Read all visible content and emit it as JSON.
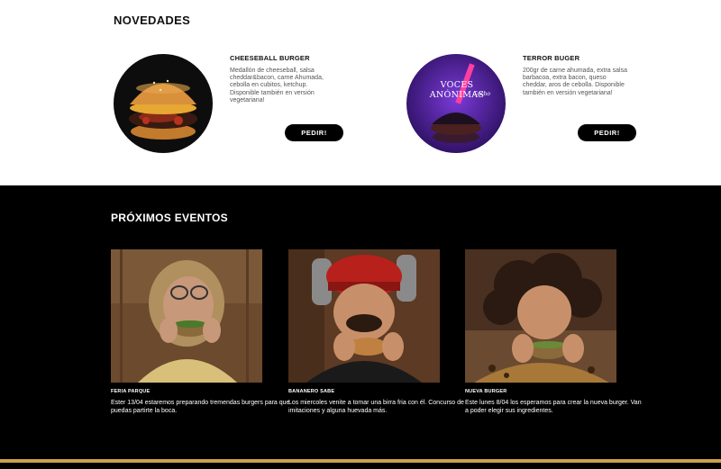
{
  "novedades": {
    "title": "NOVEDADES",
    "products": [
      {
        "name": "CHEESEBALL BURGER",
        "description": "Medallón de cheeseball, salsa cheddar&bacon, carne Ahumada, cebolla en cubitos, ketchup. Disponible también en versión vegetariana!",
        "button": "PEDIR!",
        "image_icon": "burger-photo"
      },
      {
        "name": "TERROR BUGER",
        "description": "200gr de carne ahumada, extra salsa barbacoa, extra bacon, queso cheddar, aros de cebolla. Disponible también en versión vegetariana!",
        "button": "PEDIR!",
        "image_icon": "burger-photo",
        "image_overlay_title": "VOCES ANÓNIMAS",
        "image_overlay_subtitle": "Cacho"
      }
    ]
  },
  "eventos": {
    "title": "PRÓXIMOS EVENTOS",
    "items": [
      {
        "name": "FERIA PARQUE",
        "description": "Ester 13/04 estaremos preparando tremendas burgers para que puedas partirte la boca."
      },
      {
        "name": "BANANERO SABE",
        "description": "Los miercoles venite a tomar una birra fria con él. Concurso de imitaciones y alguna huevada más."
      },
      {
        "name": "NUEVA BURGER",
        "description": "Este lunes 8/04 los esperamos para crear la nueva burger. Van a poder elegir sus ingredientes."
      }
    ]
  },
  "colors": {
    "accent_gold": "#c9a24a",
    "button_bg": "#000000",
    "events_bg": "#000000"
  }
}
